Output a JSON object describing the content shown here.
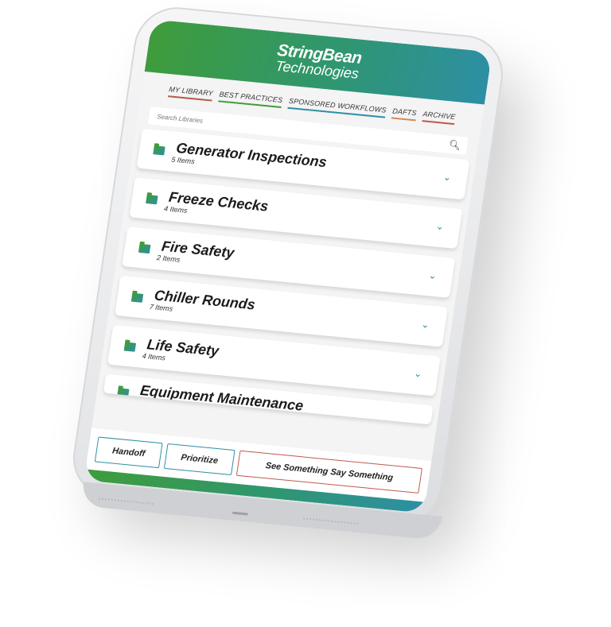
{
  "brand": {
    "line1": "StringBean",
    "line2": "Technologies"
  },
  "tabs": [
    {
      "label": "MY LIBRARY"
    },
    {
      "label": "BEST PRACTICES"
    },
    {
      "label": "SPONSORED WORKFLOWS"
    },
    {
      "label": "DAFTS"
    },
    {
      "label": "ARCHIVE"
    }
  ],
  "search": {
    "placeholder": "Search Libraries"
  },
  "libraries": [
    {
      "title": "Generator Inspections",
      "count": "5 Items"
    },
    {
      "title": "Freeze Checks",
      "count": "4 Items"
    },
    {
      "title": "Fire Safety",
      "count": "2 Items"
    },
    {
      "title": "Chiller Rounds",
      "count": "7 Items"
    },
    {
      "title": "Life Safety",
      "count": "4 Items"
    },
    {
      "title": "Equipment Maintenance"
    }
  ],
  "actions": {
    "handoff": "Handoff",
    "prioritize": "Prioritize",
    "see_something": "See Something Say Something"
  },
  "colors": {
    "accent_green": "#3f9c3a",
    "accent_teal": "#2d8fa5",
    "accent_red": "#c0584b"
  },
  "icons": {
    "search": "search-icon",
    "folder": "folder-icon",
    "chevron": "chevron-down-icon"
  }
}
